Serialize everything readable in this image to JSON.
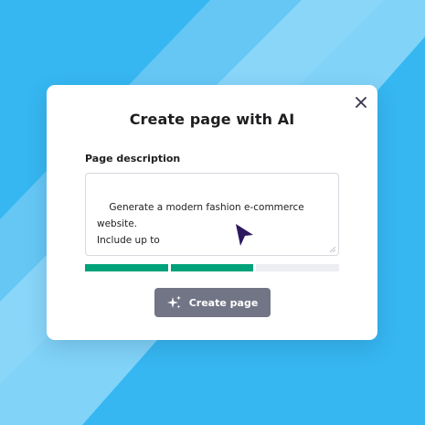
{
  "colors": {
    "background": "#36b7f1",
    "background_light": "#7dd0f7",
    "progress_filled": "#00a27a",
    "progress_empty": "#eceef1",
    "button": "#727586",
    "cursor": "#2d1960"
  },
  "modal": {
    "title": "Create page with AI",
    "close_icon": "close-icon",
    "description_label": "Page description",
    "description_value": "Generate a modern fashion e-commerce website.\nInclude up to",
    "progress": {
      "filled_segments": 2,
      "total_segments": 3
    },
    "create_button": {
      "icon": "sparkle-icon",
      "label": "Create page"
    }
  }
}
